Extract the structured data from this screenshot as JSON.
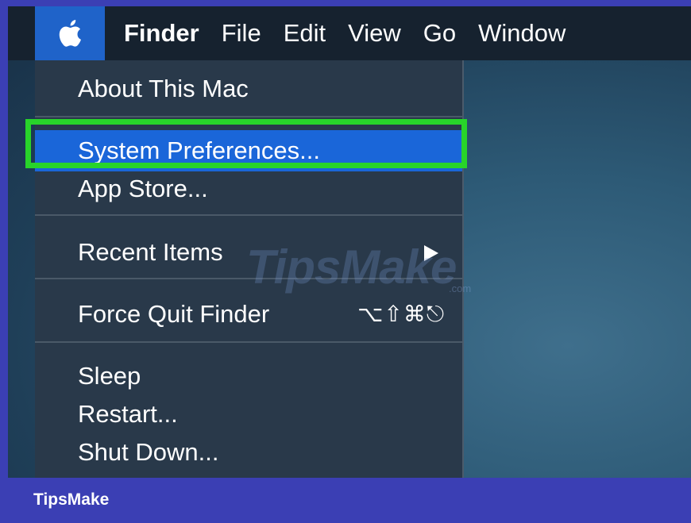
{
  "menubar": {
    "apple_icon": "apple-logo-icon",
    "app_name": "Finder",
    "menus": [
      "File",
      "Edit",
      "View",
      "Go",
      "Window"
    ]
  },
  "apple_menu": {
    "about": "About This Mac",
    "system_preferences": "System Preferences...",
    "app_store": "App Store...",
    "recent_items": "Recent Items",
    "recent_items_icon": "submenu-arrow-icon",
    "force_quit": "Force Quit Finder",
    "force_quit_shortcut": "⌥⇧⌘⎋",
    "sleep": "Sleep",
    "restart": "Restart...",
    "shut_down": "Shut Down..."
  },
  "watermark": {
    "text": "TipsMake",
    "domain": ".com"
  },
  "footer": {
    "brand": "TipsMake"
  },
  "colors": {
    "frame": "#3b3fb4",
    "menubar": "#16222f",
    "menu_background": "#29394a",
    "selection": "#1a66d9",
    "annotation_outline": "#28d42a"
  }
}
